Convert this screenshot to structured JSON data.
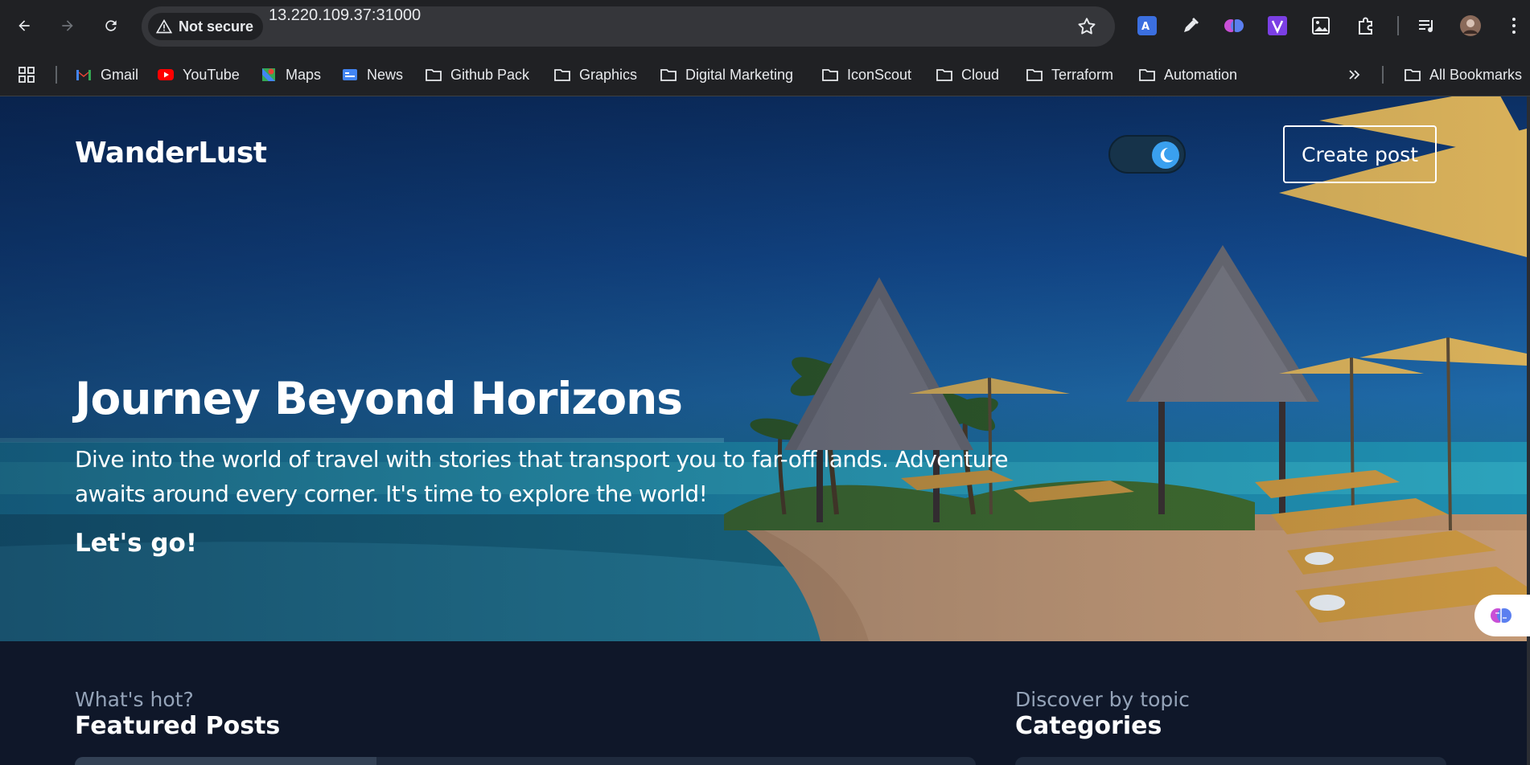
{
  "browser": {
    "security_label": "Not secure",
    "url": "13.220.109.37:31000",
    "bookmarks": [
      {
        "label": "Gmail",
        "icon": "gmail-icon"
      },
      {
        "label": "YouTube",
        "icon": "youtube-icon"
      },
      {
        "label": "Maps",
        "icon": "maps-icon"
      },
      {
        "label": "News",
        "icon": "news-icon"
      },
      {
        "label": "Github Pack",
        "icon": "folder-icon"
      },
      {
        "label": "Graphics",
        "icon": "folder-icon"
      },
      {
        "label": "Digital Marketing",
        "icon": "folder-icon"
      },
      {
        "label": "IconScout",
        "icon": "folder-icon"
      },
      {
        "label": "Cloud",
        "icon": "folder-icon"
      },
      {
        "label": "Terraform",
        "icon": "folder-icon"
      },
      {
        "label": "Automation",
        "icon": "folder-icon"
      }
    ],
    "all_bookmarks": "All Bookmarks"
  },
  "site": {
    "brand": "WanderLust",
    "create_post": "Create post",
    "theme_mode": "dark"
  },
  "hero": {
    "title": "Journey Beyond Horizons",
    "description": "Dive into the world of travel with stories that transport you to far-off lands. Adventure awaits around every corner. It's time to explore the world!",
    "cta": "Let's go!"
  },
  "featured": {
    "subtitle": "What's hot?",
    "title": "Featured Posts"
  },
  "categories": {
    "subtitle": "Discover by topic",
    "title": "Categories"
  },
  "colors": {
    "page_bg": "#0f1729",
    "toggle_knob": "#3aa0ef",
    "muted_text": "#94a3b8"
  }
}
